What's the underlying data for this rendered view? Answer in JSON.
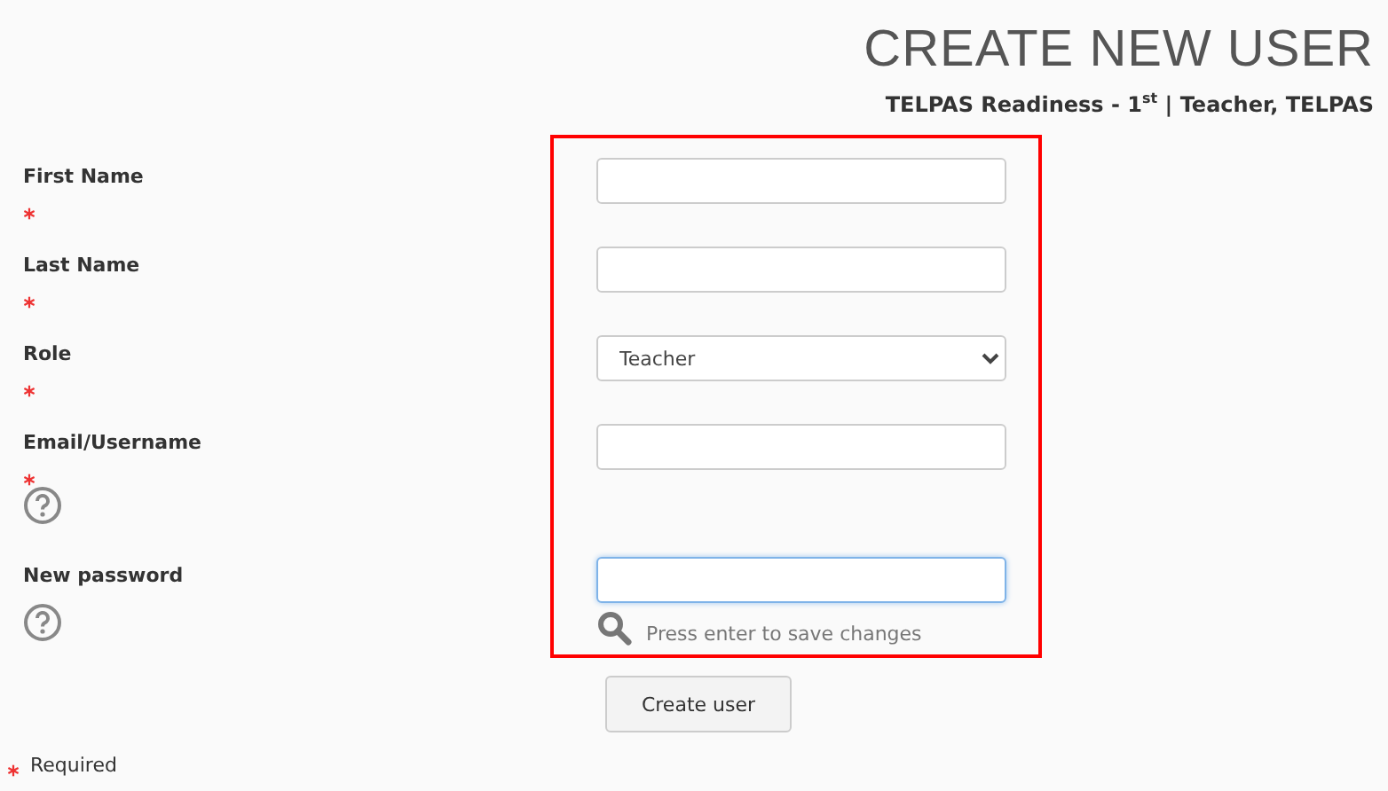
{
  "title": "CREATE NEW USER",
  "subtitle": "TELPAS Readiness - 1$^{st}$ | Teacher, TELPAS",
  "fields": [
    {
      "label": "First Name",
      "required": true,
      "help": false,
      "kind": "text",
      "focused": false
    },
    {
      "label": "Last Name",
      "required": true,
      "help": false,
      "kind": "text",
      "focused": false
    },
    {
      "label": "Role",
      "required": true,
      "help": false,
      "kind": "select",
      "value": "Teacher"
    },
    {
      "label": "Email/Username",
      "required": true,
      "help": true,
      "kind": "text",
      "focused": false
    },
    {
      "label": "New password",
      "required": false,
      "help": true,
      "kind": "password",
      "focused": true,
      "hint": "Press enter to save changes"
    }
  ],
  "submit": "Create user",
  "legend": "Required"
}
